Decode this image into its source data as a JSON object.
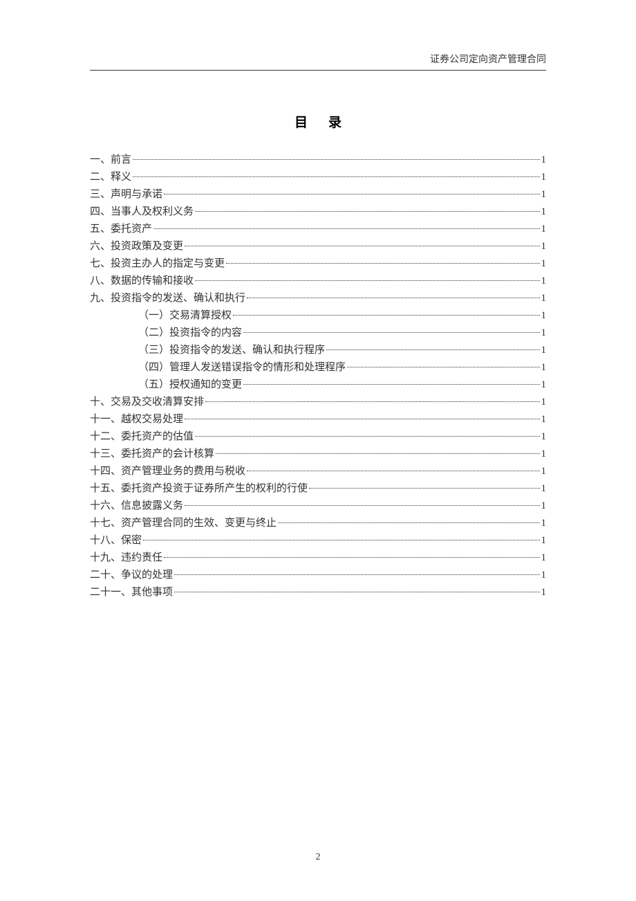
{
  "header": {
    "title": "证券公司定向资产管理合同"
  },
  "toc": {
    "title": "目录",
    "entries": [
      {
        "label": "一、前言",
        "page": "1",
        "indent": false
      },
      {
        "label": "二、释义",
        "page": "1",
        "indent": false
      },
      {
        "label": "三、声明与承诺",
        "page": "1",
        "indent": false
      },
      {
        "label": "四、当事人及权利义务",
        "page": "1",
        "indent": false
      },
      {
        "label": "五、委托资产",
        "page": "1",
        "indent": false
      },
      {
        "label": "六、投资政策及变更",
        "page": "1",
        "indent": false
      },
      {
        "label": "七、投资主办人的指定与变更",
        "page": "1",
        "indent": false
      },
      {
        "label": "八、数据的传输和接收",
        "page": "1",
        "indent": false
      },
      {
        "label": "九、投资指令的发送、确认和执行",
        "page": "1",
        "indent": false
      },
      {
        "label": "（一）交易清算授权",
        "page": "1",
        "indent": true
      },
      {
        "label": "（二）投资指令的内容",
        "page": "1",
        "indent": true
      },
      {
        "label": "（三）投资指令的发送、确认和执行程序",
        "page": "1",
        "indent": true
      },
      {
        "label": "（四）管理人发送错误指令的情形和处理程序",
        "page": "1",
        "indent": true
      },
      {
        "label": "（五）授权通知的变更",
        "page": "1",
        "indent": true
      },
      {
        "label": "十、交易及交收清算安排",
        "page": "1",
        "indent": false
      },
      {
        "label": "十一、越权交易处理",
        "page": "1",
        "indent": false
      },
      {
        "label": "十二、委托资产的估值",
        "page": "1",
        "indent": false
      },
      {
        "label": "十三、委托资产的会计核算",
        "page": "1",
        "indent": false
      },
      {
        "label": "十四、资产管理业务的费用与税收",
        "page": "1",
        "indent": false
      },
      {
        "label": "十五、委托资产投资于证券所产生的权利的行使",
        "page": "1",
        "indent": false
      },
      {
        "label": "十六、信息披露义务",
        "page": "1",
        "indent": false
      },
      {
        "label": "十七、资产管理合同的生效、变更与终止",
        "page": "1",
        "indent": false
      },
      {
        "label": "十八、保密",
        "page": "1",
        "indent": false
      },
      {
        "label": "十九、违约责任",
        "page": "1",
        "indent": false
      },
      {
        "label": "二十、争议的处理",
        "page": "1",
        "indent": false
      },
      {
        "label": "二十一、其他事项",
        "page": "1",
        "indent": false
      }
    ]
  },
  "footer": {
    "page_number": "2"
  }
}
